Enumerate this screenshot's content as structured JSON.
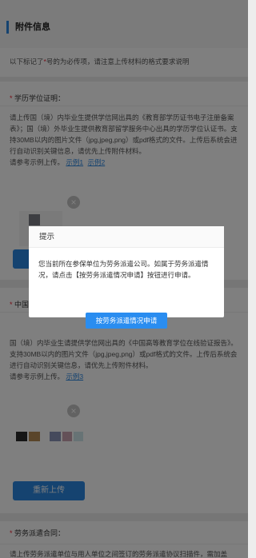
{
  "header": {
    "title": "附件信息"
  },
  "notice": {
    "prefix": "以下标记了",
    "mark": "*",
    "suffix": "号的为必传项，请注意上传材料的格式要求说明"
  },
  "sections": [
    {
      "title": "学历学位证明：",
      "required_mark": "*",
      "desc": "请上传国（境）内毕业生提供学信网出具的《教育部学历证书电子注册备案表》；国（境）外毕业生提供教育部留学服务中心出具的学历学位认证书。支持30MB以内的图片文件（jpg,jpeg,png）或pdf格式的文件。上传后系统会进行自动识别关键信息，请优先上传附件材料。",
      "sample_prefix": "请参考示例上传。",
      "sample_links": [
        "示例1",
        "示例2"
      ],
      "upload_label": ""
    },
    {
      "title_prefix": "中国",
      "required_mark": "*",
      "desc": "国（境）内毕业生请提供学信网出具的《中国高等教育学位在线验证报告》。支持30MB以内的图片文件（jpg,jpeg,png）或pdf格式的文件。上传后系统会进行自动识别关键信息，请优先上传附件材料。",
      "sample_prefix": "请参考示例上传。",
      "sample_links": [
        "示例3"
      ],
      "upload_label": "重新上传"
    },
    {
      "title": "劳务派遣合同：",
      "required_mark": "*",
      "desc": "请上传劳务派遣单位与用人单位之间签订的劳务派遣协议扫描件，需加盖"
    }
  ],
  "modal": {
    "title": "提示",
    "body": "您当前所在参保单位为劳务派遣公司。如属于劳务派遣情况，请点击【按劳务派遣情况申请】按钮进行申请。",
    "button_label": "按劳务派遣情况申请"
  },
  "colors": {
    "accent": "#2a86e0",
    "required": "#e23"
  }
}
